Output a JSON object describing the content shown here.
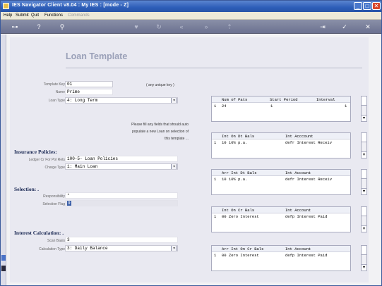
{
  "window": {
    "title": "IES Navigator Client v8.04 : My IES :       [mode - Z]"
  },
  "menu": {
    "items": [
      "Help",
      "Submit",
      "Quit",
      "Functions",
      "Commands"
    ]
  },
  "page": {
    "heading": "Loan Template"
  },
  "form": {
    "template_key": {
      "label": "Template Key",
      "value": "01",
      "hint": "( any unique key )"
    },
    "name": {
      "label": "Name",
      "value": "Prime"
    },
    "loan_type": {
      "label": "Loan Type",
      "value": "4: Long Term"
    },
    "note_lines": [
      "Please fill any fields that should auto",
      "populate a new Loan on selection of",
      "this template ..."
    ]
  },
  "insurance": {
    "title": "Insurance Policies:",
    "ledger": {
      "label": "Ledger Cr For Pol Rets",
      "value": "100-5- Loan Policies"
    },
    "charge_type": {
      "label": "Charge Type",
      "value": "1: Main Loan"
    }
  },
  "selection": {
    "title": "Selection: .",
    "responsibility": {
      "label": "Responsibility",
      "value": "*"
    },
    "selection_flag": {
      "label": "Selection Flag",
      "value": "9"
    }
  },
  "interest": {
    "title": "Interest Calculation: .",
    "scan_basis": {
      "label": "Scan Basis",
      "value": "3"
    },
    "calculation_type": {
      "label": "Calculation Type",
      "value": "3: Daily Balance"
    }
  },
  "grids": [
    {
      "headers": [
        "Num of Pats",
        "Start Period",
        "Interval"
      ],
      "row": [
        "1",
        "24",
        "1",
        "1"
      ]
    },
    {
      "headers": [
        "Int On Dt Bals",
        "Int Acccount"
      ],
      "row": [
        "1",
        "10 10% p.a.",
        "defr Interest Receiv"
      ]
    },
    {
      "headers": [
        "Arr Int Dt Bals",
        "Int Account"
      ],
      "row": [
        "1",
        "10 10% p.a.",
        "defr Interest Receiv"
      ]
    },
    {
      "headers": [
        "Int On Cr Bals",
        "Int Account"
      ],
      "row": [
        "1",
        "00 Zero Interest",
        "defp Interest Paid"
      ]
    },
    {
      "headers": [
        "Arr Int On Cr Bals",
        "Int Account"
      ],
      "row": [
        "1",
        "00 Zero Interest",
        "defp Interest Paid"
      ]
    }
  ],
  "icons": {
    "toolbar": [
      "key-icon",
      "help-icon",
      "search-icon",
      "heart-icon",
      "refresh-icon",
      "back-icon",
      "forward-icon",
      "export-icon",
      "save-icon",
      "confirm-icon",
      "close-icon"
    ]
  },
  "colors": {
    "titlebar": "#2d5db8",
    "heading": "#9aa0b8",
    "section": "#1c2a55"
  }
}
